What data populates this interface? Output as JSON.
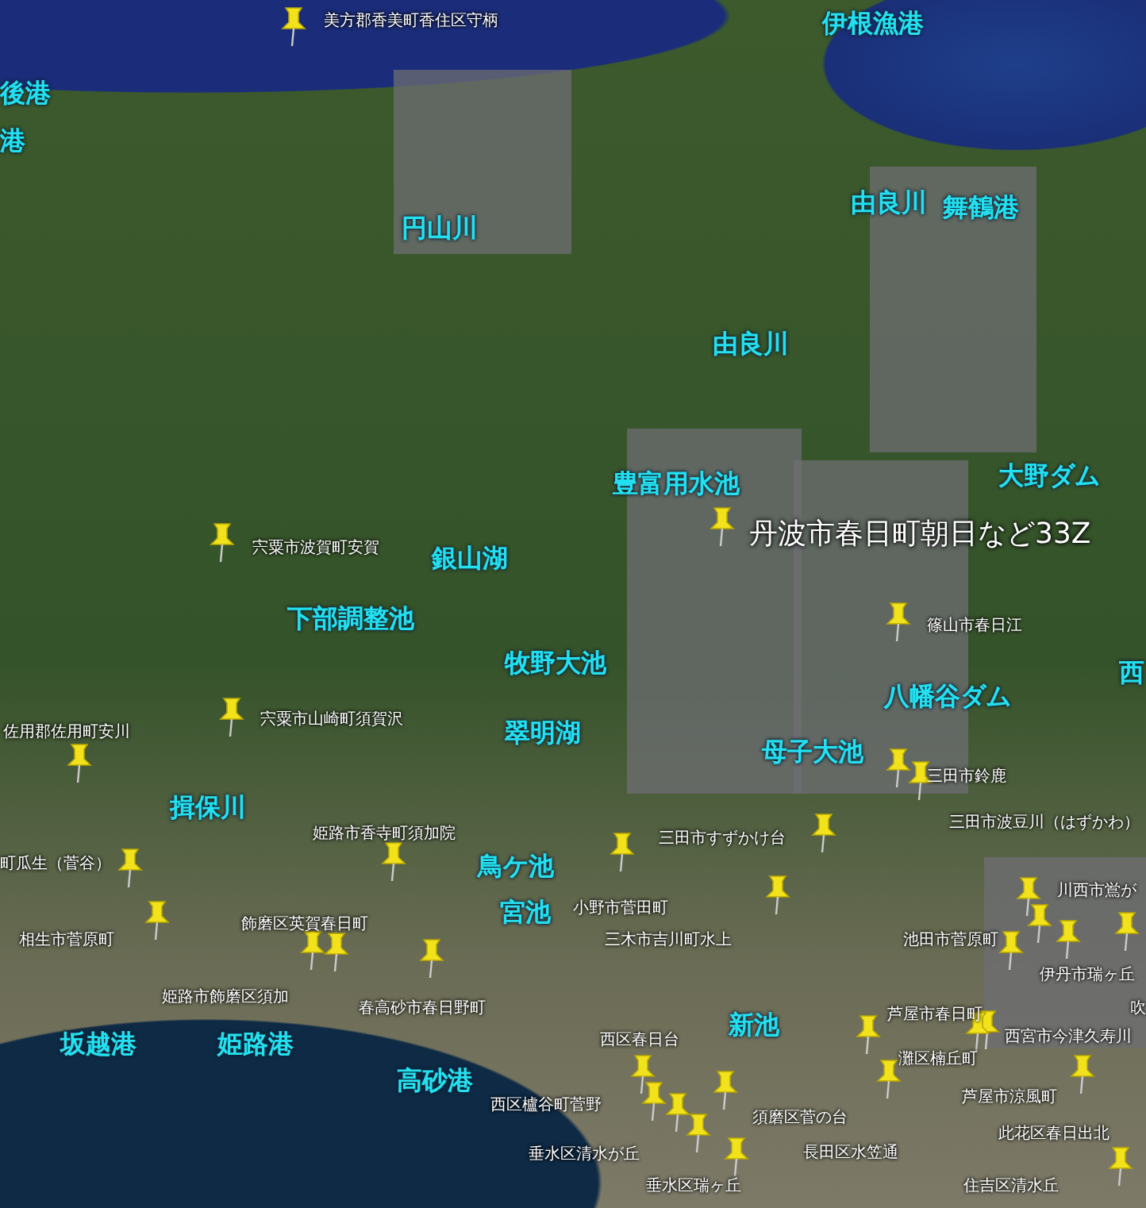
{
  "map": {
    "labels": [
      {
        "kind": "place",
        "text": "美方郡香美町香住区守柄"
      },
      {
        "kind": "water",
        "text": "伊根漁港"
      },
      {
        "kind": "water",
        "text": "後港"
      },
      {
        "kind": "water",
        "text": "港"
      },
      {
        "kind": "water",
        "text": "由良川"
      },
      {
        "kind": "water",
        "text": "舞鶴港"
      },
      {
        "kind": "water",
        "text": "円山川"
      },
      {
        "kind": "water",
        "text": "由良川"
      },
      {
        "kind": "water",
        "text": "豊富用水池"
      },
      {
        "kind": "water",
        "text": "大野ダム"
      },
      {
        "kind": "big",
        "text": "丹波市春日町朝日など33Z"
      },
      {
        "kind": "place",
        "text": "宍粟市波賀町安賀"
      },
      {
        "kind": "water",
        "text": "銀山湖"
      },
      {
        "kind": "water",
        "text": "下部調整池"
      },
      {
        "kind": "place",
        "text": "篠山市春日江"
      },
      {
        "kind": "water",
        "text": "牧野大池"
      },
      {
        "kind": "water",
        "text": "西"
      },
      {
        "kind": "water",
        "text": "八幡谷ダム"
      },
      {
        "kind": "place",
        "text": "佐用郡佐用町安川"
      },
      {
        "kind": "place",
        "text": "宍粟市山崎町須賀沢"
      },
      {
        "kind": "water",
        "text": "翠明湖"
      },
      {
        "kind": "water",
        "text": "母子大池"
      },
      {
        "kind": "place",
        "text": "三田市鈴鹿"
      },
      {
        "kind": "water",
        "text": "揖保川"
      },
      {
        "kind": "place",
        "text": "三田市波豆川（はずかわ）"
      },
      {
        "kind": "place",
        "text": "姫路市香寺町須加院"
      },
      {
        "kind": "place",
        "text": "三田市すずかけ台"
      },
      {
        "kind": "water",
        "text": "鳥ケ池"
      },
      {
        "kind": "place",
        "text": "町瓜生（菅谷）"
      },
      {
        "kind": "place",
        "text": "川西市鴬が"
      },
      {
        "kind": "water",
        "text": "宮池"
      },
      {
        "kind": "place",
        "text": "小野市菅田町"
      },
      {
        "kind": "place",
        "text": "飾磨区英賀春日町"
      },
      {
        "kind": "place",
        "text": "相生市菅原町"
      },
      {
        "kind": "place",
        "text": "三木市吉川町水上"
      },
      {
        "kind": "place",
        "text": "池田市菅原町"
      },
      {
        "kind": "place",
        "text": "伊丹市瑞ヶ丘"
      },
      {
        "kind": "place",
        "text": "姫路市飾磨区須加"
      },
      {
        "kind": "place",
        "text": "春高砂市春日野町"
      },
      {
        "kind": "water",
        "text": "新池"
      },
      {
        "kind": "place",
        "text": "芦屋市春日町"
      },
      {
        "kind": "place",
        "text": "吹"
      },
      {
        "kind": "water",
        "text": "坂越港"
      },
      {
        "kind": "water",
        "text": "姫路港"
      },
      {
        "kind": "place",
        "text": "西区春日台"
      },
      {
        "kind": "place",
        "text": "西宮市今津久寿川"
      },
      {
        "kind": "water",
        "text": "高砂港"
      },
      {
        "kind": "place",
        "text": "灘区楠丘町"
      },
      {
        "kind": "place",
        "text": "西区櫨谷町菅野"
      },
      {
        "kind": "place",
        "text": "芦屋市涼風町"
      },
      {
        "kind": "place",
        "text": "須磨区菅の台"
      },
      {
        "kind": "place",
        "text": "此花区春日出北"
      },
      {
        "kind": "place",
        "text": "垂水区清水が丘"
      },
      {
        "kind": "place",
        "text": "長田区水笠通"
      },
      {
        "kind": "place",
        "text": "垂水区瑞ヶ丘"
      },
      {
        "kind": "place",
        "text": "住吉区清水丘"
      }
    ]
  }
}
